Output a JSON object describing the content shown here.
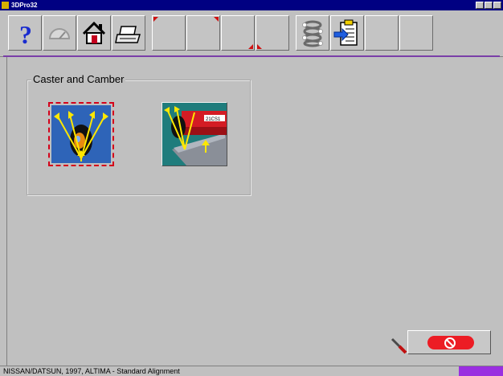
{
  "window": {
    "title": "3DPro32"
  },
  "toolbar": {
    "buttons": [
      {
        "name": "help",
        "icon": "help-icon"
      },
      {
        "name": "gauge",
        "icon": "gauge-icon"
      },
      {
        "name": "home",
        "icon": "home-icon"
      },
      {
        "name": "print",
        "icon": "printer-icon"
      },
      {
        "name": "blank-1",
        "icon": ""
      },
      {
        "name": "blank-2",
        "icon": ""
      },
      {
        "name": "blank-3",
        "icon": ""
      },
      {
        "name": "blank-4",
        "icon": ""
      },
      {
        "name": "vehicle-specs",
        "icon": "spring-icon"
      },
      {
        "name": "report",
        "icon": "clipboard-icon"
      },
      {
        "name": "blank-5",
        "icon": ""
      },
      {
        "name": "blank-6",
        "icon": ""
      }
    ]
  },
  "main": {
    "group_title": "Caster and Camber",
    "tiles": [
      {
        "name": "caster-camber-wheel-tile",
        "icon": "wheel-adjust-icon",
        "selected": true
      },
      {
        "name": "caster-camber-vehicle-tile",
        "icon": "vehicle-lift-icon",
        "selected": false
      }
    ]
  },
  "actions": {
    "cancel_icon": "no-entry-icon",
    "tool_icon": "wrench-icon"
  },
  "status": {
    "text": "NISSAN/DATSUN, 1997, ALTIMA - Standard Alignment"
  },
  "colors": {
    "titlebar": "#000082",
    "accent": "#9a2fe0",
    "cancel": "#ec1c24",
    "selection": "#d4001a"
  }
}
